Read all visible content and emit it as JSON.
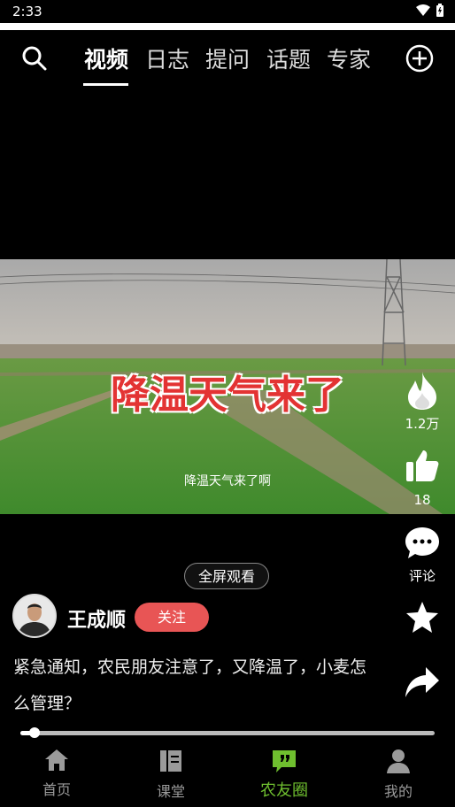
{
  "status_bar": {
    "time": "2:33"
  },
  "top_nav": {
    "tabs": [
      {
        "label": "视频",
        "active": true
      },
      {
        "label": "日志",
        "active": false
      },
      {
        "label": "提问",
        "active": false
      },
      {
        "label": "话题",
        "active": false
      },
      {
        "label": "专家",
        "active": false
      }
    ],
    "search_icon": "search-icon",
    "add_icon": "add-circle-icon"
  },
  "video": {
    "title_overlay": "降温天气来了",
    "subtitle": "降温天气来了啊",
    "fullscreen_label": "全屏观看"
  },
  "side_actions": {
    "hot_count": "1.2万",
    "like_count": "18",
    "comment_label": "评论"
  },
  "author": {
    "name": "王成顺",
    "follow_label": "关注"
  },
  "post": {
    "description": "紧急通知，农民朋友注意了，又降温了，小麦怎么管理？"
  },
  "player": {
    "progress": 0.035
  },
  "bottom_nav": {
    "items": [
      {
        "label": "首页",
        "icon": "home-icon",
        "active": false
      },
      {
        "label": "课堂",
        "icon": "book-icon",
        "active": false
      },
      {
        "label": "农友圈",
        "icon": "chat-quote-icon",
        "active": true
      },
      {
        "label": "我的",
        "icon": "person-icon",
        "active": false
      }
    ]
  },
  "colors": {
    "accent_green": "#6fbf2f",
    "follow_red": "#e85555",
    "overlay_red": "#e33333"
  }
}
